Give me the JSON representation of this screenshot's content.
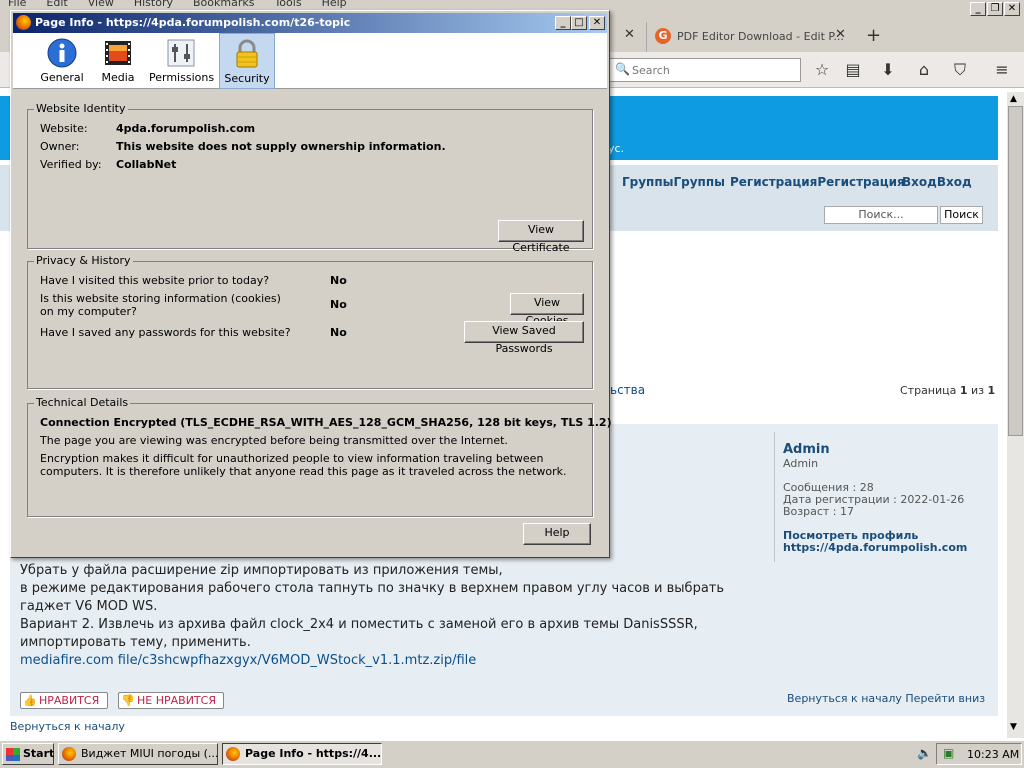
{
  "menubar": {
    "items": [
      "File",
      "Edit",
      "View",
      "History",
      "Bookmarks",
      "Tools",
      "Help"
    ]
  },
  "browser": {
    "tab_title": "PDF Editor Download - Edit P...",
    "search_placeholder": "Search"
  },
  "forum": {
    "subtitle_fragment": "ус.",
    "nav": {
      "groups": "ГруппыГруппы",
      "register": "РегистрацияРегистрация",
      "login": "ВходВход"
    },
    "search_placeholder": "Поиск...",
    "search_button": "Поиск",
    "fragment_link": "ьства",
    "pagination": {
      "label": "Страница",
      "current": "1",
      "of": "из",
      "total": "1"
    },
    "post": {
      "author": "Admin",
      "rank": "Admin",
      "messages": "Сообщения : 28",
      "registered": "Дата регистрации : 2022-01-26",
      "age": "Возраст : 17",
      "view_profile": "Посмотреть профиль",
      "profile_url": "https://4pda.forumpolish.com",
      "lines": [
        "Убрать у файла расширение zip импортировать из приложения темы,",
        "в режиме редактирования рабочего стола тапнуть по значку в верхнем правом углу часов и выбрать",
        "гаджет V6 MOD WS.",
        "Вариант 2. Извлечь из архива файл clock_2x4 и поместить с заменой его в архив темы DanisSSSR,",
        "импортировать тему, применить."
      ],
      "link": "mediafire.com file/c3shcwpfhazxgyx/V6MOD_WStock_v1.1.mtz.zip/file",
      "like": "НРАВИТСЯ",
      "dislike": "НЕ НРАВИТСЯ",
      "back_top": "Вернуться к началу",
      "go_down": "Перейти вниз"
    },
    "footer_back": "Вернуться к началу"
  },
  "dialog": {
    "title": "Page Info - https://4pda.forumpolish.com/t26-topic",
    "tabs": [
      {
        "label": "General",
        "icon": "info-icon"
      },
      {
        "label": "Media",
        "icon": "media-icon"
      },
      {
        "label": "Permissions",
        "icon": "permissions-icon"
      },
      {
        "label": "Security",
        "icon": "lock-icon"
      }
    ],
    "identity": {
      "group": "Website Identity",
      "website_label": "Website:",
      "website": "4pda.forumpolish.com",
      "owner_label": "Owner:",
      "owner": "This website does not supply ownership information.",
      "verified_label": "Verified by:",
      "verified": "CollabNet",
      "view_certificate": "View Certificate"
    },
    "privacy": {
      "group": "Privacy & History",
      "q1": "Have I visited this website prior to today?",
      "a1": "No",
      "q2": "Is this website storing information (cookies) on my computer?",
      "a2": "No",
      "view_cookies": "View Cookies",
      "q3": "Have I saved any passwords for this website?",
      "a3": "No",
      "view_passwords": "View Saved Passwords"
    },
    "technical": {
      "group": "Technical Details",
      "headline": "Connection Encrypted (TLS_ECDHE_RSA_WITH_AES_128_GCM_SHA256, 128 bit keys, TLS 1.2)",
      "line1": "The page you are viewing was encrypted before being transmitted over the Internet.",
      "line2": "Encryption makes it difficult for unauthorized people to view information traveling between computers. It is therefore unlikely that anyone read this page as it traveled across the network."
    },
    "help": "Help"
  },
  "taskbar": {
    "start": "Start",
    "items": [
      "Виджет MIUI погоды (...",
      "Page Info - https://4..."
    ],
    "clock": "10:23 AM"
  }
}
